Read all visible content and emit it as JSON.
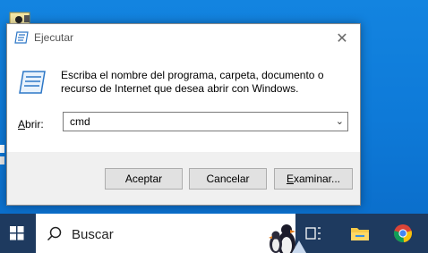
{
  "dialog": {
    "title": "Ejecutar",
    "description_line1": "Escriba el nombre del programa, carpeta, documento o",
    "description_line2": "recurso de Internet que desea abrir con Windows.",
    "open_label_prefix": "A",
    "open_label_rest": "brir:",
    "input_value": "cmd",
    "ok_label": "Aceptar",
    "cancel_label": "Cancelar",
    "browse_prefix": "E",
    "browse_rest": "xaminar..."
  },
  "taskbar": {
    "search_placeholder": "Buscar",
    "items": [
      "task-view-icon",
      "file-explorer-icon",
      "chrome-icon"
    ]
  },
  "colors": {
    "desktop": "#0e7ad8",
    "taskbar": "#1e3a5f",
    "button_face": "#e1e1e1"
  }
}
